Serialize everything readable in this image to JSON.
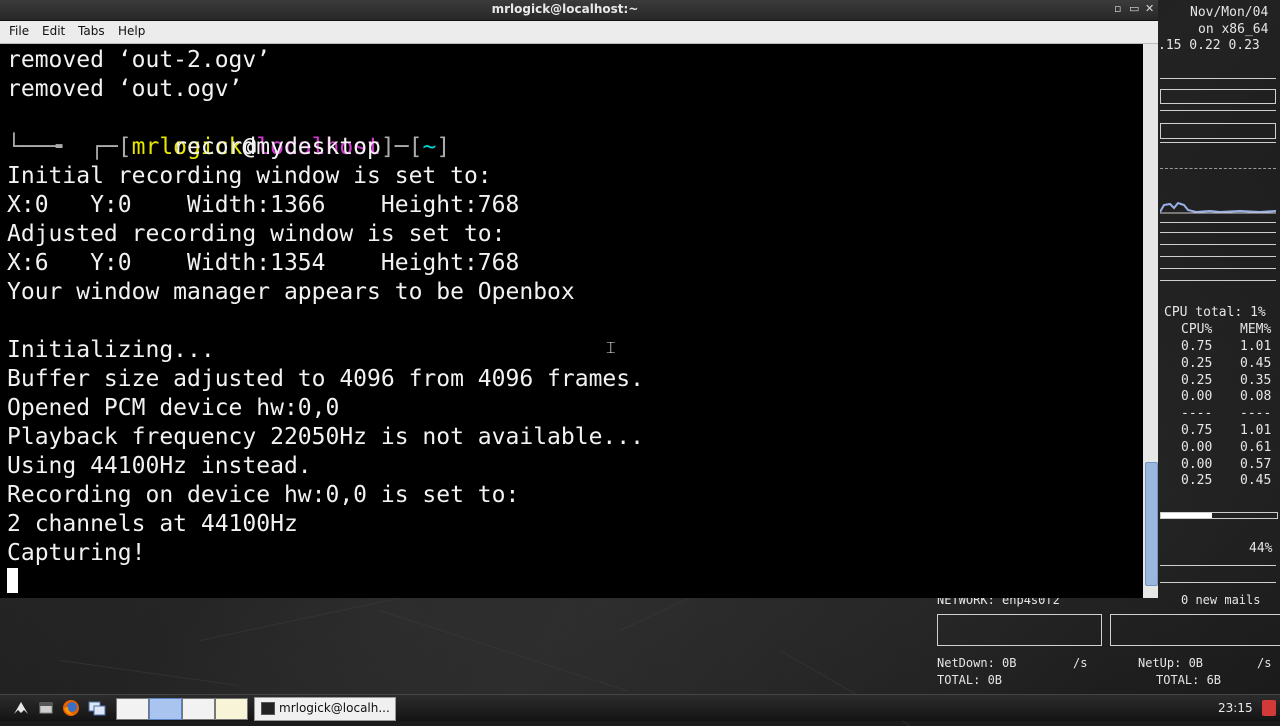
{
  "window": {
    "title": "mrlogick@localhost:~",
    "controls": [
      "▫",
      "▭",
      "✕"
    ]
  },
  "menu": [
    "File",
    "Edit",
    "Tabs",
    "Help"
  ],
  "terminal": {
    "lines": [
      "removed ‘out-2.ogv’",
      "removed ‘out.ogv’",
      "",
      "        recordmydesktop",
      "Initial recording window is set to:",
      "X:0   Y:0    Width:1366    Height:768",
      "Adjusted recording window is set to:",
      "X:6   Y:0    Width:1354    Height:768",
      "Your window manager appears to be Openbox",
      "",
      "Initializing...",
      "Buffer size adjusted to 4096 from 4096 frames.",
      "Opened PCM device hw:0,0",
      "Playback frequency 22050Hz is not available...",
      "Using 44100Hz instead.",
      "Recording on device hw:0,0 is set to:",
      "2 channels at 44100Hz",
      "Capturing!"
    ],
    "prompt": {
      "open": "┌─[",
      "user": "mrlogick",
      "at": "@",
      "host": "localhost",
      "sep": "]─[",
      "dir": "~",
      "close": "]",
      "second": "└──╼"
    },
    "colors": {
      "user": "#e6e600",
      "host": "#d23ad2",
      "dir": "#00d7d7",
      "frame": "#aaaaaa"
    }
  },
  "conky": {
    "date": "Nov/Mon/04",
    "arch": "on x86_64",
    "load": ".15 0.22 0.23",
    "cpu_total_label": "CPU total:",
    "cpu_total_value": "1%",
    "cpu_header": "CPU%",
    "mem_header": "MEM%",
    "process_rows": [
      [
        "0.75",
        "1.01"
      ],
      [
        "0.25",
        "0.45"
      ],
      [
        "0.25",
        "0.35"
      ],
      [
        "0.00",
        "0.08"
      ],
      [
        "----",
        "----"
      ],
      [
        "0.75",
        "1.01"
      ],
      [
        "0.00",
        "0.61"
      ],
      [
        "0.00",
        "0.57"
      ],
      [
        "0.25",
        "0.45"
      ]
    ],
    "bar_percent_label": "44%",
    "bar_fill": 0.44,
    "network_label": "NETWORK: enp4s0f2",
    "mail_label": "0 new mails",
    "net_down_label": "NetDown: 0B",
    "net_down_unit": "/s",
    "net_up_label": "NetUp: 0B",
    "net_up_unit": "/s",
    "total_down_label": "TOTAL: 0B",
    "total_up_label": "TOTAL: 6B"
  },
  "taskbar": {
    "task_label": "mrlogick@localh...",
    "clock": "23:15",
    "icons": [
      "openbox-menu-icon",
      "show-desktop-icon",
      "firefox-icon",
      "window-list-icon",
      "desktop-pager-icon"
    ]
  }
}
